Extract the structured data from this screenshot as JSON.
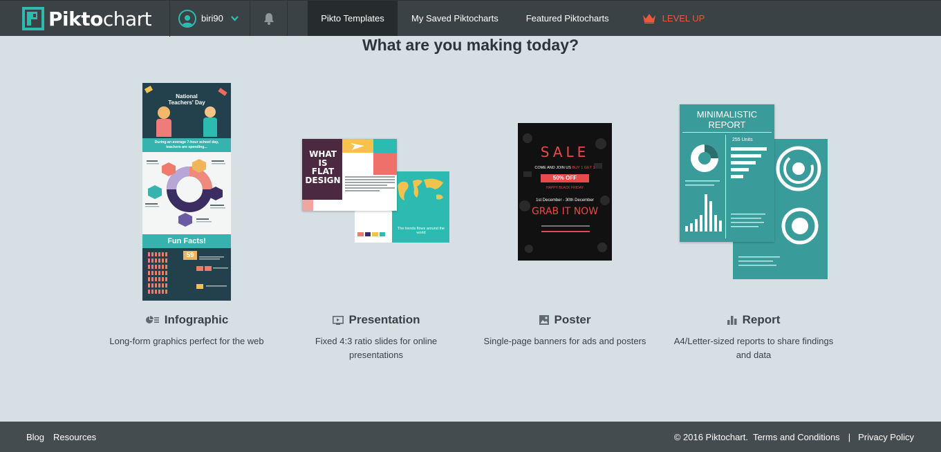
{
  "nav": {
    "logo_bold": "Pikto",
    "logo_light": "chart",
    "username": "biri90",
    "tabs": [
      {
        "label": "Pikto Templates",
        "active": true
      },
      {
        "label": "My Saved Piktocharts",
        "active": false
      },
      {
        "label": "Featured Piktocharts",
        "active": false
      }
    ],
    "level_up": "LEVEL UP",
    "accent": "#f0583c",
    "teal": "#2dbbb1"
  },
  "heading": "What are you making today?",
  "cards": [
    {
      "title": "Infographic",
      "icon": "infographic-icon",
      "desc": "Long-form graphics perfect for the web"
    },
    {
      "title": "Presentation",
      "icon": "presentation-icon",
      "desc_line1": "Fixed 4:3 ratio slides for online",
      "desc_line2": "presentations"
    },
    {
      "title": "Poster",
      "icon": "image-icon",
      "desc": "Single-page banners for ads and posters"
    },
    {
      "title": "Report",
      "icon": "bar-chart-icon",
      "desc_line1": "A4/Letter-sized reports to share findings",
      "desc_line2": "and data"
    }
  ],
  "thumbs": {
    "infographic": {
      "title_line1": "National",
      "title_line2": "Teachers' Day",
      "banner_line1": "During an average 7-hour school day,",
      "banner_line2": "teachers are spending...",
      "fun_facts": "Fun Facts!",
      "fact_number": "59"
    },
    "presentation": {
      "line1": "WHAT",
      "line2": "IS",
      "line3": "FLAT",
      "line4": "DESIGN",
      "caption": "The trends flows around the world"
    },
    "poster": {
      "sale": "SALE",
      "come": "COME AND JOIN US",
      "buy": "BUY 1 GET 1",
      "off": "50% OFF",
      "black": "HAPPY BLACK FRIDAY",
      "dates": "1st December - 30th December",
      "grab": "GRAB IT NOW"
    },
    "report": {
      "title_line1": "MINIMALISTIC",
      "title_line2": "REPORT",
      "units": "255 Units"
    }
  },
  "footer": {
    "blog": "Blog",
    "resources": "Resources",
    "copyright": "© 2016 Piktochart.",
    "terms": "Terms and Conditions",
    "separator": "|",
    "privacy": "Privacy Policy"
  }
}
